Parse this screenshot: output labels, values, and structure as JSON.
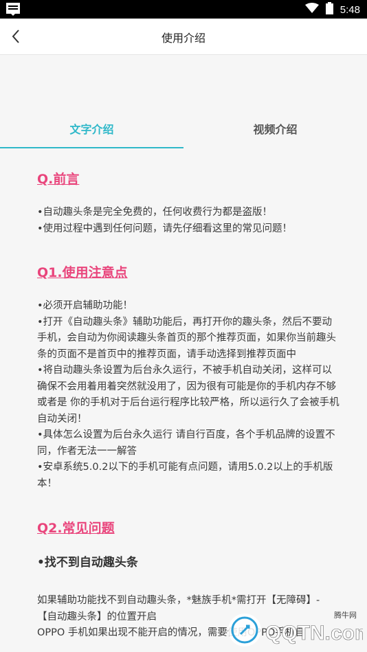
{
  "status_bar": {
    "time": "5:48"
  },
  "app_bar": {
    "title": "使用介绍"
  },
  "tabs": [
    {
      "label": "文字介绍",
      "active": true
    },
    {
      "label": "视频介绍",
      "active": false
    }
  ],
  "sections": {
    "preface": {
      "heading": "Q.前言",
      "lines": [
        "•自动趣头条是完全免费的，任何收费行为都是盗版！",
        "•使用过程中遇到任何问题，请先仔细看这里的常见问题！"
      ]
    },
    "q1": {
      "heading": "Q1.使用注意点",
      "text": "•必须开启辅助功能！\n•打开《自动趣头条》辅助功能后，再打开你的趣头条，然后不要动手机，会自动为你阅读趣头条首页的那个推荐页面，如果你当前趣头条的页面不是首页中的推荐页面，请手动选择到推荐页面中\n•将自动趣头条设置为后台永久运行，不被手机自动关闭，这样可以确保不会用着用着突然就没用了，因为很有可能是你的手机内存不够或者是 你的手机对于后台运行程序比较严格，所以运行久了会被手机自动关闭！\n•具体怎么设置为后台永久运行 请自行百度，各个手机品牌的设置不同，作者无法一一解答\n•安卓系统5.0.2以下的手机可能有点问题，请用5.0.2以上的手机版本！"
    },
    "q2": {
      "heading": "Q2.常见问题",
      "subheading": "•找不到自动趣头条",
      "text": "如果辅助功能找不到自动趣头条，*魅族手机*需打开【无障碍】-【自动趣头条】的位置开启\nOPPO 手机如果出现不能开启的情况，需要使用OPPO手机自"
    }
  },
  "watermark": {
    "brand": "QQTN.com",
    "small": "腾牛网"
  },
  "colors": {
    "accent": "#2fb8c9",
    "heading": "#e9457c"
  }
}
